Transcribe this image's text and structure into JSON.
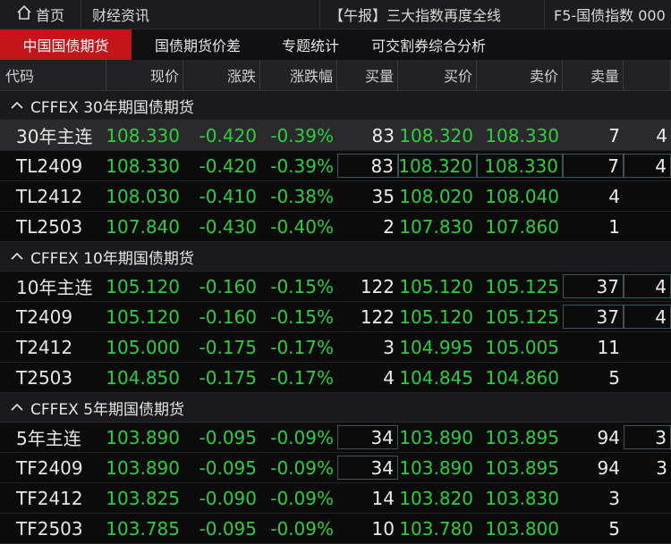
{
  "topbar": {
    "home": "首页",
    "news": "财经资讯",
    "headline": "【午报】三大指数再度全线",
    "f5": "F5-国债指数 000"
  },
  "tabs": [
    {
      "label": "中国国债期货",
      "active": true
    },
    {
      "label": "国债期货价差",
      "active": false
    },
    {
      "label": "专题统计",
      "active": false
    },
    {
      "label": "可交割券综合分析",
      "active": false
    }
  ],
  "columns": [
    "代码",
    "现价",
    "涨跌",
    "涨跌幅",
    "买量",
    "买价",
    "卖价",
    "卖量",
    ""
  ],
  "groups": [
    {
      "title": "CFFEX 30年期国债期货",
      "rows": [
        {
          "code": "30年主连",
          "price": "108.330",
          "change": "-0.420",
          "pct": "-0.39%",
          "bidvol": "83",
          "bid": "108.320",
          "ask": "108.330",
          "askvol": "7",
          "extra": "4"
        },
        {
          "code": "TL2409",
          "price": "108.330",
          "change": "-0.420",
          "pct": "-0.39%",
          "bidvol": "83",
          "bid": "108.320",
          "ask": "108.330",
          "askvol": "7",
          "extra": "4"
        },
        {
          "code": "TL2412",
          "price": "108.030",
          "change": "-0.410",
          "pct": "-0.38%",
          "bidvol": "35",
          "bid": "108.020",
          "ask": "108.040",
          "askvol": "4",
          "extra": ""
        },
        {
          "code": "TL2503",
          "price": "107.840",
          "change": "-0.430",
          "pct": "-0.40%",
          "bidvol": "2",
          "bid": "107.830",
          "ask": "107.860",
          "askvol": "1",
          "extra": ""
        }
      ]
    },
    {
      "title": "CFFEX 10年期国债期货",
      "rows": [
        {
          "code": "10年主连",
          "price": "105.120",
          "change": "-0.160",
          "pct": "-0.15%",
          "bidvol": "122",
          "bid": "105.120",
          "ask": "105.125",
          "askvol": "37",
          "extra": "4"
        },
        {
          "code": "T2409",
          "price": "105.120",
          "change": "-0.160",
          "pct": "-0.15%",
          "bidvol": "122",
          "bid": "105.120",
          "ask": "105.125",
          "askvol": "37",
          "extra": "4"
        },
        {
          "code": "T2412",
          "price": "105.000",
          "change": "-0.175",
          "pct": "-0.17%",
          "bidvol": "3",
          "bid": "104.995",
          "ask": "105.005",
          "askvol": "11",
          "extra": ""
        },
        {
          "code": "T2503",
          "price": "104.850",
          "change": "-0.175",
          "pct": "-0.17%",
          "bidvol": "4",
          "bid": "104.845",
          "ask": "104.860",
          "askvol": "5",
          "extra": ""
        }
      ]
    },
    {
      "title": "CFFEX 5年期国债期货",
      "rows": [
        {
          "code": "5年主连",
          "price": "103.890",
          "change": "-0.095",
          "pct": "-0.09%",
          "bidvol": "34",
          "bid": "103.890",
          "ask": "103.895",
          "askvol": "94",
          "extra": "3"
        },
        {
          "code": "TF2409",
          "price": "103.890",
          "change": "-0.095",
          "pct": "-0.09%",
          "bidvol": "34",
          "bid": "103.890",
          "ask": "103.895",
          "askvol": "94",
          "extra": "3"
        },
        {
          "code": "TF2412",
          "price": "103.825",
          "change": "-0.090",
          "pct": "-0.09%",
          "bidvol": "14",
          "bid": "103.820",
          "ask": "103.830",
          "askvol": "3",
          "extra": ""
        },
        {
          "code": "TF2503",
          "price": "103.785",
          "change": "-0.095",
          "pct": "-0.09%",
          "bidvol": "10",
          "bid": "103.780",
          "ask": "103.800",
          "askvol": "5",
          "extra": ""
        }
      ]
    }
  ],
  "colors": {
    "accent": "#c4151b",
    "down": "#2fcc3f"
  }
}
